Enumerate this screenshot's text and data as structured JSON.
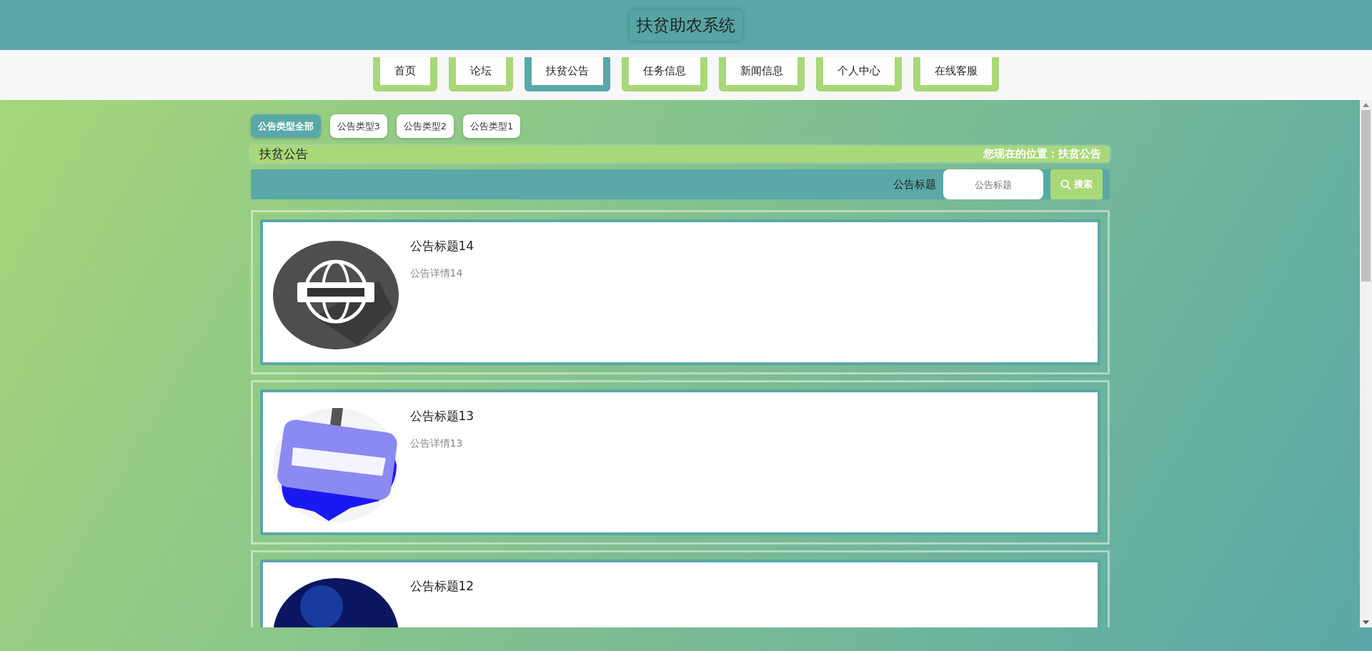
{
  "header": {
    "title": "扶贫助农系统"
  },
  "nav": [
    {
      "label": "首页",
      "selected": false
    },
    {
      "label": "论坛",
      "selected": false
    },
    {
      "label": "扶贫公告",
      "selected": true
    },
    {
      "label": "任务信息",
      "selected": false
    },
    {
      "label": "新闻信息",
      "selected": false
    },
    {
      "label": "个人中心",
      "selected": false
    },
    {
      "label": "在线客服",
      "selected": false
    }
  ],
  "filters": [
    {
      "label": "公告类型全部",
      "selected": true
    },
    {
      "label": "公告类型3",
      "selected": false
    },
    {
      "label": "公告类型2",
      "selected": false
    },
    {
      "label": "公告类型1",
      "selected": false
    }
  ],
  "breadcrumb": {
    "title": "扶贫公告",
    "location": "您现在的位置：扶贫公告"
  },
  "search": {
    "label": "公告标题",
    "placeholder": "公告标题",
    "button": "搜索"
  },
  "notices": [
    {
      "title": "公告标题14",
      "detail": "公告详情14",
      "kind": "picture"
    },
    {
      "title": "公告标题13",
      "detail": "公告详情13",
      "kind": "picture"
    },
    {
      "title": "公告标题12",
      "kind": "picture"
    }
  ]
}
